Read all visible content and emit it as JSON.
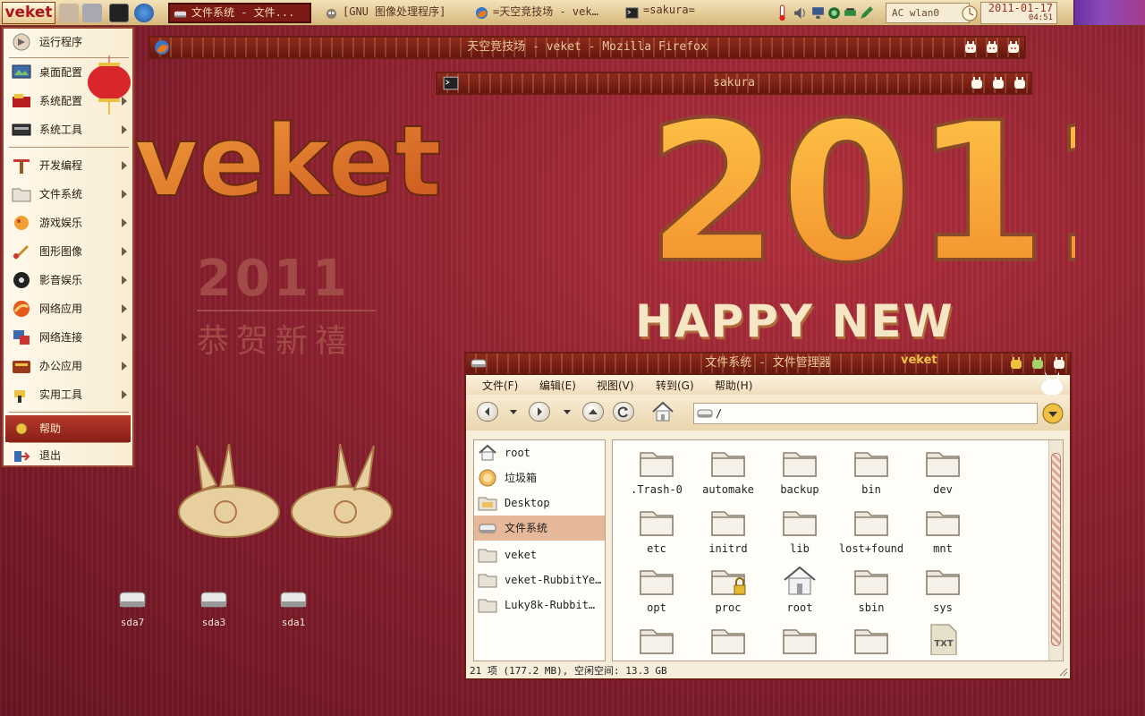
{
  "taskbar": {
    "start_label": "veket",
    "tasks": [
      {
        "label": "文件系统 - 文件...",
        "active": true
      },
      {
        "label": "[GNU 图像处理程序]",
        "active": false
      },
      {
        "label": "=天空竞技场 - vek…",
        "active": false
      },
      {
        "label": "=sakura=",
        "active": false
      }
    ],
    "network": "AC wlan0",
    "date": "2011-01-17",
    "time": "04:51"
  },
  "windows": {
    "firefox_title": "天空竞技场 - veket - Mozilla Firefox",
    "terminal_title": "sakura"
  },
  "start_menu": {
    "items": [
      {
        "label": "运行程序",
        "icon": "run-icon",
        "submenu": false
      },
      {
        "label": "桌面配置",
        "icon": "desktop-config-icon",
        "submenu": true
      },
      {
        "label": "系统配置",
        "icon": "system-config-icon",
        "submenu": true
      },
      {
        "label": "系统工具",
        "icon": "system-tools-icon",
        "submenu": true
      },
      {
        "label": "开发编程",
        "icon": "dev-icon",
        "submenu": true
      },
      {
        "label": "文件系统",
        "icon": "folder-icon",
        "submenu": true
      },
      {
        "label": "游戏娱乐",
        "icon": "game-icon",
        "submenu": true
      },
      {
        "label": "图形图像",
        "icon": "graphics-icon",
        "submenu": true
      },
      {
        "label": "影音娱乐",
        "icon": "media-icon",
        "submenu": true
      },
      {
        "label": "网络应用",
        "icon": "network-app-icon",
        "submenu": true
      },
      {
        "label": "网络连接",
        "icon": "network-connect-icon",
        "submenu": true
      },
      {
        "label": "办公应用",
        "icon": "office-icon",
        "submenu": true
      },
      {
        "label": "实用工具",
        "icon": "utility-icon",
        "submenu": true
      },
      {
        "label": "帮助",
        "icon": "help-icon",
        "submenu": false
      },
      {
        "label": "退出",
        "icon": "exit-icon",
        "submenu": false
      }
    ]
  },
  "desktop": {
    "icons": [
      {
        "label": "sda7"
      },
      {
        "label": "sda3"
      },
      {
        "label": "sda1"
      }
    ],
    "wallpaper_brand": "veket",
    "wallpaper_year": "2011",
    "wallpaper_greeting": "HAPPY NEW YEAR",
    "wallpaper_cn_year": "2011",
    "wallpaper_cn_greeting": "恭贺新禧"
  },
  "file_manager": {
    "title": "文件系统 - 文件管理器",
    "brand": "veket",
    "menu": [
      "文件(F)",
      "编辑(E)",
      "视图(V)",
      "转到(G)",
      "帮助(H)"
    ],
    "location": "/",
    "sidebar": [
      {
        "label": "root",
        "icon": "home-icon",
        "selected": false
      },
      {
        "label": "垃圾箱",
        "icon": "trash-icon",
        "selected": false
      },
      {
        "label": "Desktop",
        "icon": "desktop-folder-icon",
        "selected": false
      },
      {
        "label": "文件系统",
        "icon": "drive-icon",
        "selected": true
      },
      {
        "label": "veket",
        "icon": "folder-icon",
        "selected": false
      },
      {
        "label": "veket-RubbitYe…",
        "icon": "folder-icon",
        "selected": false
      },
      {
        "label": "Luky8k-Rubbit…",
        "icon": "folder-icon",
        "selected": false
      }
    ],
    "files": [
      {
        "label": ".Trash-0",
        "icon": "folder-icon"
      },
      {
        "label": "automake",
        "icon": "folder-icon"
      },
      {
        "label": "backup",
        "icon": "folder-icon"
      },
      {
        "label": "bin",
        "icon": "folder-icon"
      },
      {
        "label": "dev",
        "icon": "folder-icon"
      },
      {
        "label": "etc",
        "icon": "folder-icon"
      },
      {
        "label": "initrd",
        "icon": "folder-icon"
      },
      {
        "label": "lib",
        "icon": "folder-icon"
      },
      {
        "label": "lost+found",
        "icon": "folder-icon"
      },
      {
        "label": "mnt",
        "icon": "folder-icon"
      },
      {
        "label": "opt",
        "icon": "folder-icon"
      },
      {
        "label": "proc",
        "icon": "locked-folder-icon"
      },
      {
        "label": "root",
        "icon": "home-folder-icon"
      },
      {
        "label": "sbin",
        "icon": "folder-icon"
      },
      {
        "label": "sys",
        "icon": "folder-icon"
      },
      {
        "label": "",
        "icon": "folder-icon"
      },
      {
        "label": "",
        "icon": "folder-icon"
      },
      {
        "label": "",
        "icon": "folder-icon"
      },
      {
        "label": "",
        "icon": "folder-icon"
      },
      {
        "label": "",
        "icon": "txt-file-icon"
      }
    ],
    "status": "21 项 (177.2 MB), 空闲空间: 13.3 GB"
  },
  "colors": {
    "accent": "#8c2130",
    "menu_highlight": "#b43a2c",
    "selection": "#e6b89a"
  }
}
